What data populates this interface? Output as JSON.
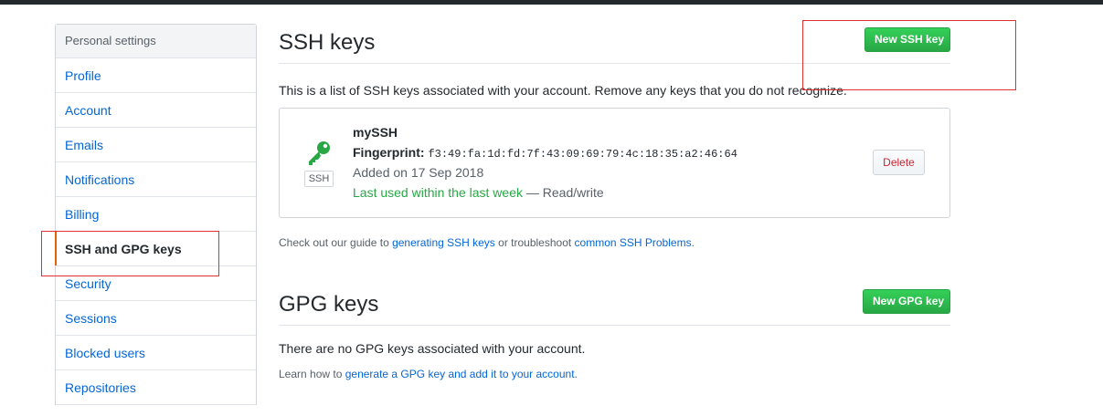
{
  "sidebar": {
    "header": "Personal settings",
    "items": [
      {
        "label": "Profile"
      },
      {
        "label": "Account"
      },
      {
        "label": "Emails"
      },
      {
        "label": "Notifications"
      },
      {
        "label": "Billing"
      },
      {
        "label": "SSH and GPG keys",
        "selected": true
      },
      {
        "label": "Security"
      },
      {
        "label": "Sessions"
      },
      {
        "label": "Blocked users"
      },
      {
        "label": "Repositories"
      }
    ]
  },
  "ssh": {
    "title": "SSH keys",
    "new_button": "New SSH key",
    "description": "This is a list of SSH keys associated with your account. Remove any keys that you do not recognize.",
    "key": {
      "icon": "key-icon",
      "type_badge": "SSH",
      "title": "mySSH",
      "fingerprint_label": "Fingerprint:",
      "fingerprint": "f3:49:fa:1d:fd:7f:43:09:69:79:4c:18:35:a2:46:64",
      "added": "Added on 17 Sep 2018",
      "last_used": "Last used within the last week",
      "access": "— Read/write",
      "delete_button": "Delete"
    },
    "guide": {
      "prefix": "Check out our guide to ",
      "link1": "generating SSH keys",
      "middle": " or troubleshoot ",
      "link2": "common SSH Problems",
      "suffix": "."
    }
  },
  "gpg": {
    "title": "GPG keys",
    "new_button": "New GPG key",
    "empty": "There are no GPG keys associated with your account.",
    "learn": {
      "prefix": "Learn how to ",
      "link": "generate a GPG key and add it to your account",
      "suffix": "."
    }
  },
  "colors": {
    "accent_selected": "#e36209",
    "link": "#0366d6",
    "primary_button": "#28a745",
    "danger": "#cb2431",
    "annotation": "#e03131"
  }
}
